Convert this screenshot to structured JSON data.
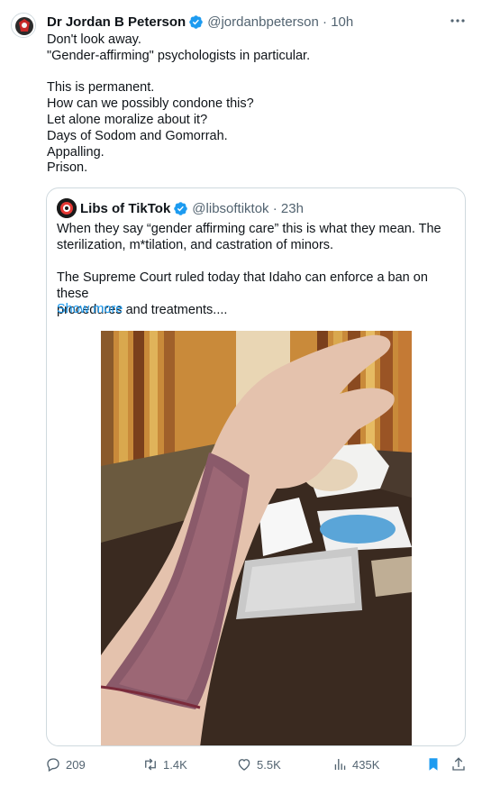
{
  "tweet": {
    "author_name": "Dr Jordan B Peterson",
    "handle_time": "@jordanbpeterson · 10h",
    "lines": [
      "Don't look away.",
      "\"Gender-affirming\" psychologists in particular.",
      "",
      "This is permanent.",
      "How can we possibly condone this?",
      "Let alone moralize about it?",
      "Days of Sodom and Gomorrah.",
      "Appalling.",
      "Prison."
    ]
  },
  "quote": {
    "author_name": "Libs of TikTok",
    "handle_time": "@libsoftiktok · 23h",
    "lines": [
      "When they say “gender affirming care” this is what they mean. The",
      "sterilization, m*tilation, and castration of minors.",
      "",
      "The Supreme Court ruled today that Idaho can enforce a ban on these",
      "procedures and treatments...."
    ],
    "show_more": "Show more"
  },
  "actions": {
    "replies": "209",
    "reposts": "1.4K",
    "likes": "5.5K",
    "views": "435K"
  },
  "colors": {
    "accent": "#1d9bf0",
    "bookmark": "#1d9bf0",
    "secondary_text": "#536471"
  },
  "icons": [
    "verified-badge-icon",
    "more-icon",
    "reply-icon",
    "repost-icon",
    "like-icon",
    "views-icon",
    "bookmark-icon",
    "share-icon"
  ]
}
